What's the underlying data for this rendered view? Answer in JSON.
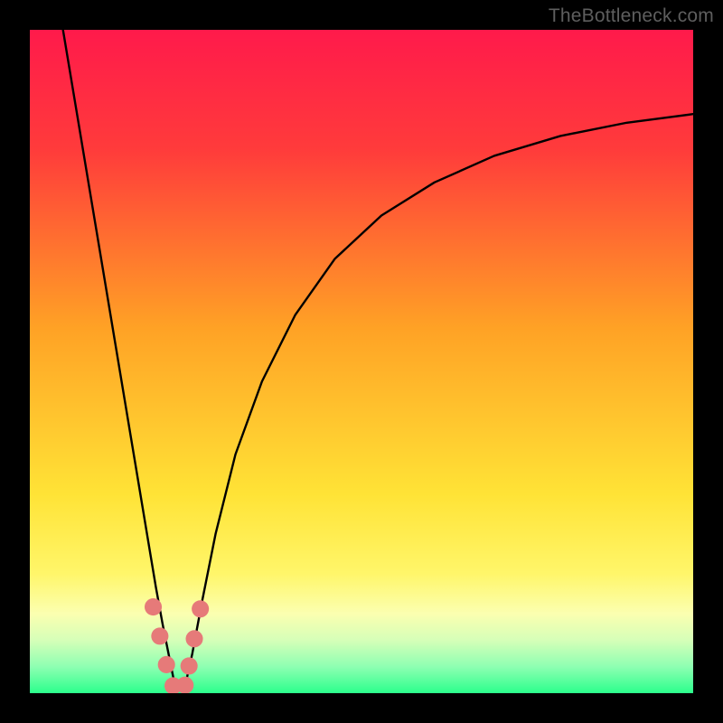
{
  "watermark": "TheBottleneck.com",
  "chart_data": {
    "type": "line",
    "title": "",
    "xlabel": "",
    "ylabel": "",
    "xlim": [
      0,
      100
    ],
    "ylim": [
      0,
      100
    ],
    "grid": false,
    "legend": false,
    "background_gradient": {
      "stops": [
        {
          "pos": 0.0,
          "color": "#ff1a4b"
        },
        {
          "pos": 0.18,
          "color": "#ff3b3b"
        },
        {
          "pos": 0.45,
          "color": "#ffa225"
        },
        {
          "pos": 0.7,
          "color": "#ffe336"
        },
        {
          "pos": 0.82,
          "color": "#fff66a"
        },
        {
          "pos": 0.88,
          "color": "#fbffb0"
        },
        {
          "pos": 0.92,
          "color": "#d6ffb8"
        },
        {
          "pos": 0.96,
          "color": "#8effb2"
        },
        {
          "pos": 1.0,
          "color": "#2bff8c"
        }
      ]
    },
    "series": [
      {
        "name": "left-branch",
        "x": [
          5.0,
          7.0,
          9.0,
          11.0,
          13.0,
          15.0,
          16.5,
          18.0,
          19.0,
          20.0,
          21.0,
          21.8
        ],
        "y": [
          100.0,
          88.0,
          76.0,
          64.0,
          52.0,
          40.0,
          31.0,
          22.0,
          16.0,
          10.5,
          5.5,
          1.5
        ]
      },
      {
        "name": "right-branch",
        "x": [
          23.5,
          24.5,
          26.0,
          28.0,
          31.0,
          35.0,
          40.0,
          46.0,
          53.0,
          61.0,
          70.0,
          80.0,
          90.0,
          100.0
        ],
        "y": [
          1.5,
          6.0,
          14.0,
          24.0,
          36.0,
          47.0,
          57.0,
          65.5,
          72.0,
          77.0,
          81.0,
          84.0,
          86.0,
          87.3
        ]
      },
      {
        "name": "bottom-join",
        "x": [
          21.8,
          22.3,
          22.9,
          23.5
        ],
        "y": [
          1.5,
          0.7,
          0.7,
          1.5
        ]
      }
    ],
    "markers": {
      "name": "highlight-dots",
      "color": "#e67a79",
      "radius_percent": 1.3,
      "points": [
        {
          "x": 18.6,
          "y": 13.0
        },
        {
          "x": 19.6,
          "y": 8.6
        },
        {
          "x": 20.6,
          "y": 4.3
        },
        {
          "x": 21.6,
          "y": 1.1
        },
        {
          "x": 23.4,
          "y": 1.2
        },
        {
          "x": 24.0,
          "y": 4.1
        },
        {
          "x": 24.8,
          "y": 8.2
        },
        {
          "x": 25.7,
          "y": 12.7
        }
      ]
    }
  }
}
